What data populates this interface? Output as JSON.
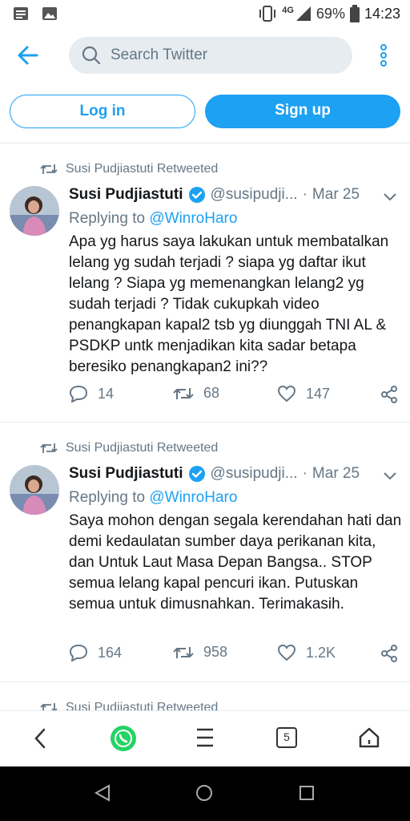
{
  "status_bar": {
    "network": "4G",
    "battery": "69%",
    "time": "14:23"
  },
  "header": {
    "search_placeholder": "Search Twitter"
  },
  "auth": {
    "login_label": "Log in",
    "signup_label": "Sign up"
  },
  "tweets": [
    {
      "retweet_label": "Susi Pudjiastuti Retweeted",
      "name": "Susi Pudjiastuti",
      "handle": "@susipudji...",
      "date": "Mar 25",
      "replying_prefix": "Replying to ",
      "replying_to": "@WinroHaro",
      "text": "Apa yg harus saya lakukan untuk membatalkan lelang yg sudah terjadi ? siapa yg daftar ikut lelang ? Siapa yg memenangkan lelang2 yg sudah terjadi ? Tidak cukupkah video penangkapan kapal2 tsb yg diunggah TNI AL & PSDKP untk menjadikan kita sadar betapa beresiko penangkapan2 ini??",
      "replies": "14",
      "retweets": "68",
      "likes": "147"
    },
    {
      "retweet_label": "Susi Pudjiastuti Retweeted",
      "name": "Susi Pudjiastuti",
      "handle": "@susipudji...",
      "date": "Mar 25",
      "replying_prefix": "Replying to ",
      "replying_to": "@WinroHaro",
      "text": "Saya mohon dengan segala kerendahan hati dan demi kedaulatan sumber daya perikanan kita, dan Untuk Laut Masa Depan Bangsa.. STOP semua lelang kapal pencuri ikan. Putuskan semua untuk dimusnahkan. Terimakasih.",
      "replies": "164",
      "retweets": "958",
      "likes": "1.2K"
    },
    {
      "retweet_label": "Susi Pudjiastuti Retweeted"
    }
  ],
  "bottom_nav": {
    "tabs_count": "5"
  },
  "colors": {
    "accent": "#1da1f2",
    "muted": "#657786",
    "whatsapp": "#25d366"
  },
  "icons": [
    "back-arrow-icon",
    "search-icon",
    "more-vertical-icon",
    "retweet-icon",
    "verified-icon",
    "chevron-down-icon",
    "reply-icon",
    "like-icon",
    "share-icon",
    "whatsapp-icon",
    "menu-icon",
    "tabs-icon",
    "home-icon"
  ]
}
